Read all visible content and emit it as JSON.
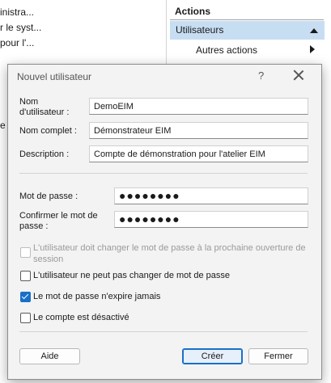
{
  "background": {
    "tree_items": [
      "inistra...",
      "r le syst...",
      "pour l'..."
    ],
    "fragment": "e",
    "actions": {
      "title": "Actions",
      "group": "Utilisateurs",
      "item": "Autres actions"
    }
  },
  "dialog": {
    "title": "Nouvel utilisateur",
    "help_label": "?",
    "fields": {
      "username_label_line1": "Nom",
      "username_label_line2": "d'utilisateur :",
      "username_value": "DemoEIM",
      "fullname_label": "Nom complet :",
      "fullname_value": "Démonstrateur EIM",
      "description_label": "Description :",
      "description_value": "Compte de démonstration pour l'atelier EIM",
      "password_label": "Mot de passe :",
      "password_value": "●●●●●●●●",
      "confirm_label_line1": "Confirmer le mot de",
      "confirm_label_line2": "passe :",
      "confirm_value": "●●●●●●●●"
    },
    "options": [
      {
        "label_line1": "L'utilisateur doit changer le mot de passe à la prochaine ouverture de",
        "label_line2": "session",
        "checked": false,
        "enabled": false
      },
      {
        "label": "L'utilisateur ne peut pas changer de mot de passe",
        "checked": false,
        "enabled": true
      },
      {
        "label": "Le mot de passe n'expire jamais",
        "checked": true,
        "enabled": true
      },
      {
        "label": "Le compte est désactivé",
        "checked": false,
        "enabled": true
      }
    ],
    "buttons": {
      "help": "Aide",
      "create": "Créer",
      "close": "Fermer"
    }
  }
}
